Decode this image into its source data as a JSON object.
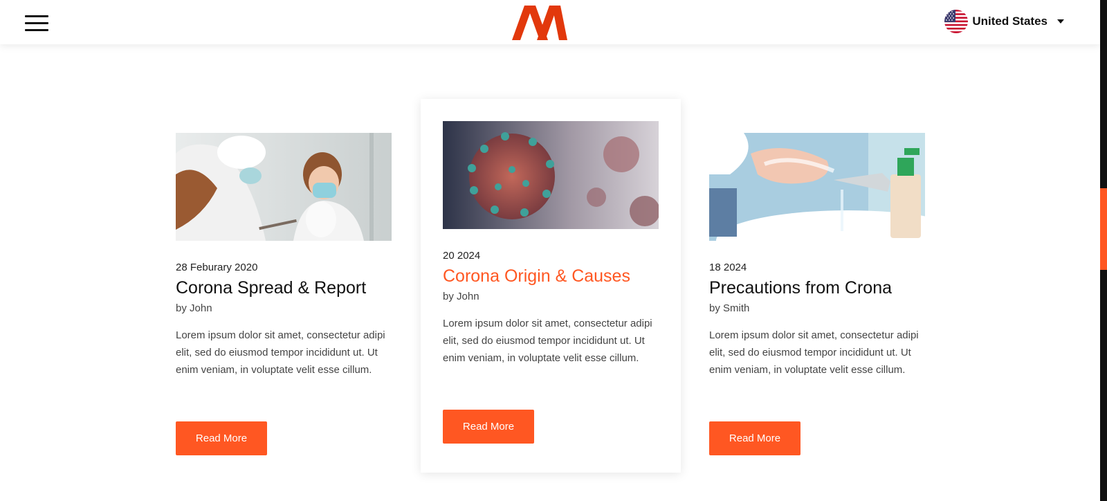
{
  "header": {
    "menu_icon": "hamburger-menu-icon",
    "logo_icon": "brand-logo-icon",
    "country": {
      "label": "United States",
      "flag_icon": "us-flag-icon",
      "dropdown_icon": "caret-down-icon"
    }
  },
  "colors": {
    "accent": "#ff5722",
    "text": "#111111",
    "muted": "#444444"
  },
  "cards": [
    {
      "image_icon": "doctor-child-mask-image",
      "date": "28 Feburary 2020",
      "title": "Corona Spread & Report",
      "author": "by John",
      "text": "Lorem ipsum dolor sit amet, consectetur adipi elit, sed do eiusmod tempor incididunt ut. Ut enim veniam, in voluptate velit esse cillum.",
      "button": "Read More"
    },
    {
      "image_icon": "coronavirus-particle-image",
      "date": "20 2024",
      "title": "Corona Origin & Causes",
      "author": "by John",
      "text": "Lorem ipsum dolor sit amet, consectetur adipi elit, sed do eiusmod tempor incididunt ut. Ut enim veniam, in voluptate velit esse cillum.",
      "button": "Read More"
    },
    {
      "image_icon": "hand-washing-image",
      "date": "18 2024",
      "title": "Precautions from Crona",
      "author": "by Smith",
      "text": "Lorem ipsum dolor sit amet, consectetur adipi elit, sed do eiusmod tempor incididunt ut. Ut enim veniam, in voluptate velit esse cillum.",
      "button": "Read More"
    }
  ]
}
